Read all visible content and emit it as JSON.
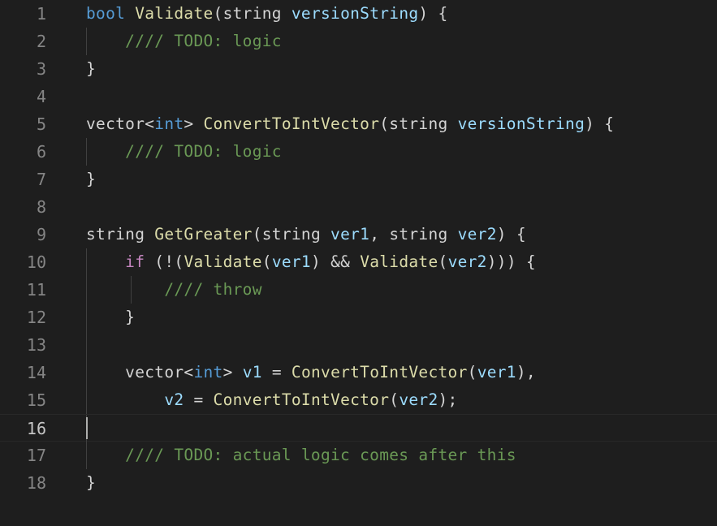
{
  "editor": {
    "language": "cpp",
    "theme": "dark-plus",
    "background_color": "#1e1e1e",
    "active_line_number": 16,
    "total_lines": 18,
    "cursor": {
      "line": 16,
      "column": 1
    },
    "colors": {
      "keyword": "#569cd6",
      "control_keyword": "#c586c0",
      "function": "#dcdcaa",
      "comment": "#6a9955",
      "plain": "#d4d4d4",
      "variable": "#9cdcfe",
      "line_number": "#858585",
      "line_number_active": "#c6c6c6",
      "indent_guide": "#404040",
      "active_line_border": "#282828",
      "cursor": "#aeafad"
    }
  },
  "lines": [
    {
      "number": "1",
      "indent_guides": 0,
      "tokens": [
        {
          "text": "bool",
          "cls": "t-key"
        },
        {
          "text": " ",
          "cls": "t-plain"
        },
        {
          "text": "Validate",
          "cls": "t-fn"
        },
        {
          "text": "(",
          "cls": "t-punct"
        },
        {
          "text": "string",
          "cls": "t-plain"
        },
        {
          "text": " ",
          "cls": "t-plain"
        },
        {
          "text": "versionString",
          "cls": "t-var"
        },
        {
          "text": ") {",
          "cls": "t-punct"
        }
      ]
    },
    {
      "number": "2",
      "indent_guides": 1,
      "tokens": [
        {
          "text": "    ",
          "cls": "t-plain"
        },
        {
          "text": "//// TODO: logic",
          "cls": "t-com"
        }
      ]
    },
    {
      "number": "3",
      "indent_guides": 0,
      "tokens": [
        {
          "text": "}",
          "cls": "t-punct"
        }
      ]
    },
    {
      "number": "4",
      "indent_guides": 0,
      "tokens": []
    },
    {
      "number": "5",
      "indent_guides": 0,
      "tokens": [
        {
          "text": "vector",
          "cls": "t-plain"
        },
        {
          "text": "<",
          "cls": "t-punct"
        },
        {
          "text": "int",
          "cls": "t-key"
        },
        {
          "text": "> ",
          "cls": "t-punct"
        },
        {
          "text": "ConvertToIntVector",
          "cls": "t-fn"
        },
        {
          "text": "(",
          "cls": "t-punct"
        },
        {
          "text": "string",
          "cls": "t-plain"
        },
        {
          "text": " ",
          "cls": "t-plain"
        },
        {
          "text": "versionString",
          "cls": "t-var"
        },
        {
          "text": ") {",
          "cls": "t-punct"
        }
      ]
    },
    {
      "number": "6",
      "indent_guides": 1,
      "tokens": [
        {
          "text": "    ",
          "cls": "t-plain"
        },
        {
          "text": "//// TODO: logic",
          "cls": "t-com"
        }
      ]
    },
    {
      "number": "7",
      "indent_guides": 0,
      "tokens": [
        {
          "text": "}",
          "cls": "t-punct"
        }
      ]
    },
    {
      "number": "8",
      "indent_guides": 0,
      "tokens": []
    },
    {
      "number": "9",
      "indent_guides": 0,
      "tokens": [
        {
          "text": "string",
          "cls": "t-plain"
        },
        {
          "text": " ",
          "cls": "t-plain"
        },
        {
          "text": "GetGreater",
          "cls": "t-fn"
        },
        {
          "text": "(",
          "cls": "t-punct"
        },
        {
          "text": "string",
          "cls": "t-plain"
        },
        {
          "text": " ",
          "cls": "t-plain"
        },
        {
          "text": "ver1",
          "cls": "t-var"
        },
        {
          "text": ", ",
          "cls": "t-punct"
        },
        {
          "text": "string",
          "cls": "t-plain"
        },
        {
          "text": " ",
          "cls": "t-plain"
        },
        {
          "text": "ver2",
          "cls": "t-var"
        },
        {
          "text": ") {",
          "cls": "t-punct"
        }
      ]
    },
    {
      "number": "10",
      "indent_guides": 1,
      "tokens": [
        {
          "text": "    ",
          "cls": "t-plain"
        },
        {
          "text": "if",
          "cls": "t-ctrl"
        },
        {
          "text": " (!(",
          "cls": "t-punct"
        },
        {
          "text": "Validate",
          "cls": "t-fn"
        },
        {
          "text": "(",
          "cls": "t-punct"
        },
        {
          "text": "ver1",
          "cls": "t-var"
        },
        {
          "text": ") && ",
          "cls": "t-punct"
        },
        {
          "text": "Validate",
          "cls": "t-fn"
        },
        {
          "text": "(",
          "cls": "t-punct"
        },
        {
          "text": "ver2",
          "cls": "t-var"
        },
        {
          "text": "))) {",
          "cls": "t-punct"
        }
      ]
    },
    {
      "number": "11",
      "indent_guides": 2,
      "tokens": [
        {
          "text": "        ",
          "cls": "t-plain"
        },
        {
          "text": "//// throw",
          "cls": "t-com"
        }
      ]
    },
    {
      "number": "12",
      "indent_guides": 1,
      "tokens": [
        {
          "text": "    ",
          "cls": "t-plain"
        },
        {
          "text": "}",
          "cls": "t-punct"
        }
      ]
    },
    {
      "number": "13",
      "indent_guides": 1,
      "tokens": []
    },
    {
      "number": "14",
      "indent_guides": 1,
      "tokens": [
        {
          "text": "    ",
          "cls": "t-plain"
        },
        {
          "text": "vector",
          "cls": "t-plain"
        },
        {
          "text": "<",
          "cls": "t-punct"
        },
        {
          "text": "int",
          "cls": "t-key"
        },
        {
          "text": "> ",
          "cls": "t-punct"
        },
        {
          "text": "v1",
          "cls": "t-var"
        },
        {
          "text": " = ",
          "cls": "t-punct"
        },
        {
          "text": "ConvertToIntVector",
          "cls": "t-fn"
        },
        {
          "text": "(",
          "cls": "t-punct"
        },
        {
          "text": "ver1",
          "cls": "t-var"
        },
        {
          "text": "),",
          "cls": "t-punct"
        }
      ]
    },
    {
      "number": "15",
      "indent_guides": 1,
      "tokens": [
        {
          "text": "        ",
          "cls": "t-plain"
        },
        {
          "text": "v2",
          "cls": "t-var"
        },
        {
          "text": " = ",
          "cls": "t-punct"
        },
        {
          "text": "ConvertToIntVector",
          "cls": "t-fn"
        },
        {
          "text": "(",
          "cls": "t-punct"
        },
        {
          "text": "ver2",
          "cls": "t-var"
        },
        {
          "text": ");",
          "cls": "t-punct"
        }
      ]
    },
    {
      "number": "16",
      "indent_guides": 1,
      "active": true,
      "cursor": true,
      "tokens": []
    },
    {
      "number": "17",
      "indent_guides": 1,
      "tokens": [
        {
          "text": "    ",
          "cls": "t-plain"
        },
        {
          "text": "//// TODO: actual logic comes after this",
          "cls": "t-com"
        }
      ]
    },
    {
      "number": "18",
      "indent_guides": 0,
      "tokens": [
        {
          "text": "}",
          "cls": "t-punct"
        }
      ]
    }
  ]
}
